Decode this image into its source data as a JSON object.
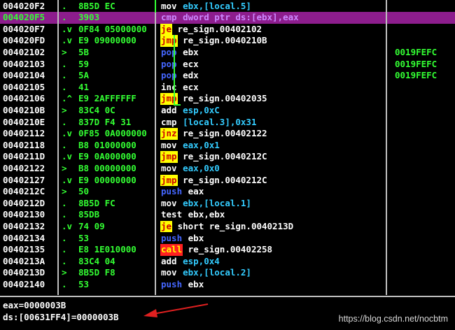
{
  "colors": {
    "background": "#000000",
    "selection": "#8d1d8d",
    "hex": "#33ff33",
    "jump_bg": "#ffff00",
    "call_bg": "#ff2020"
  },
  "rows": [
    {
      "addr": "004020F2",
      "mark": ".",
      "hex": "8B5D EC",
      "mnem": "mov",
      "ops": "ebx,[local.5]",
      "cmt": ""
    },
    {
      "addr": "004020F5",
      "mark": ".",
      "hex": "3903",
      "mnem": "cmp",
      "ops": "dword ptr ds:[ebx],eax",
      "cmt": ""
    },
    {
      "addr": "004020F7",
      "mark": ".v",
      "hex": "0F84 05000000",
      "mnem": "je",
      "ops": "re_sign.00402102",
      "cmt": ""
    },
    {
      "addr": "004020FD",
      "mark": ".v",
      "hex": "E9 09000000",
      "mnem": "jmp",
      "ops": "re_sign.0040210B",
      "cmt": ""
    },
    {
      "addr": "00402102",
      "mark": ">",
      "hex": "5B",
      "mnem": "pop",
      "ops": "ebx",
      "cmt": "0019FEFC"
    },
    {
      "addr": "00402103",
      "mark": ".",
      "hex": "59",
      "mnem": "pop",
      "ops": "ecx",
      "cmt": "0019FEFC"
    },
    {
      "addr": "00402104",
      "mark": ".",
      "hex": "5A",
      "mnem": "pop",
      "ops": "edx",
      "cmt": "0019FEFC"
    },
    {
      "addr": "00402105",
      "mark": ".",
      "hex": "41",
      "mnem": "inc",
      "ops": "ecx",
      "cmt": ""
    },
    {
      "addr": "00402106",
      "mark": ".^",
      "hex": "E9 2AFFFFFF",
      "mnem": "jmp",
      "ops": "re_sign.00402035",
      "cmt": ""
    },
    {
      "addr": "0040210B",
      "mark": ">",
      "hex": "83C4 0C",
      "mnem": "add",
      "ops": "esp,0xC",
      "cmt": ""
    },
    {
      "addr": "0040210E",
      "mark": ".",
      "hex": "837D F4 31",
      "mnem": "cmp",
      "ops": "[local.3],0x31",
      "cmt": ""
    },
    {
      "addr": "00402112",
      "mark": ".v",
      "hex": "0F85 0A000000",
      "mnem": "jnz",
      "ops": "re_sign.00402122",
      "cmt": ""
    },
    {
      "addr": "00402118",
      "mark": ".",
      "hex": "B8 01000000",
      "mnem": "mov",
      "ops": "eax,0x1",
      "cmt": ""
    },
    {
      "addr": "0040211D",
      "mark": ".v",
      "hex": "E9 0A000000",
      "mnem": "jmp",
      "ops": "re_sign.0040212C",
      "cmt": ""
    },
    {
      "addr": "00402122",
      "mark": ">",
      "hex": "B8 00000000",
      "mnem": "mov",
      "ops": "eax,0x0",
      "cmt": ""
    },
    {
      "addr": "00402127",
      "mark": ".v",
      "hex": "E9 00000000",
      "mnem": "jmp",
      "ops": "re_sign.0040212C",
      "cmt": ""
    },
    {
      "addr": "0040212C",
      "mark": ">",
      "hex": "50",
      "mnem": "push",
      "ops": "eax",
      "cmt": ""
    },
    {
      "addr": "0040212D",
      "mark": ".",
      "hex": "8B5D FC",
      "mnem": "mov",
      "ops": "ebx,[local.1]",
      "cmt": ""
    },
    {
      "addr": "00402130",
      "mark": ".",
      "hex": "85DB",
      "mnem": "test",
      "ops": "ebx,ebx",
      "cmt": ""
    },
    {
      "addr": "00402132",
      "mark": ".v",
      "hex": "74 09",
      "mnem": "je",
      "ops": "short re_sign.0040213D",
      "cmt": ""
    },
    {
      "addr": "00402134",
      "mark": ".",
      "hex": "53",
      "mnem": "push",
      "ops": "ebx",
      "cmt": ""
    },
    {
      "addr": "00402135",
      "mark": ".",
      "hex": "E8 1E010000",
      "mnem": "call",
      "ops": "re_sign.00402258",
      "cmt": ""
    },
    {
      "addr": "0040213A",
      "mark": ".",
      "hex": "83C4 04",
      "mnem": "add",
      "ops": "esp,0x4",
      "cmt": ""
    },
    {
      "addr": "0040213D",
      "mark": ">",
      "hex": "8B5D F8",
      "mnem": "mov",
      "ops": "ebx,[local.2]",
      "cmt": ""
    },
    {
      "addr": "00402140",
      "mark": ".",
      "hex": "53",
      "mnem": "push",
      "ops": "ebx",
      "cmt": ""
    }
  ],
  "selected_index": 1,
  "info": {
    "line1": "eax=0000003B",
    "line2": "ds:[00631FF4]=0000003B"
  },
  "watermark": "https://blog.csdn.net/nocbtm"
}
